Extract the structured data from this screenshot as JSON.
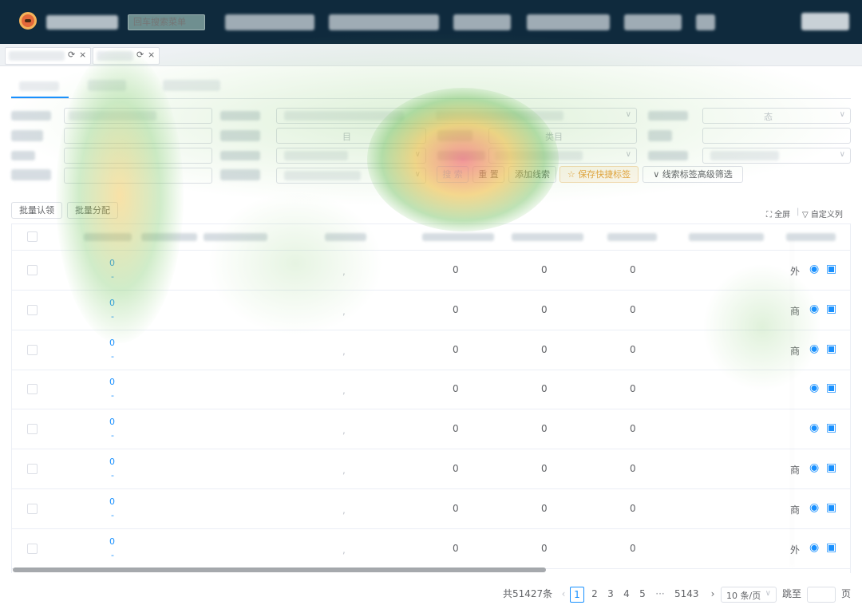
{
  "topbar": {
    "search_placeholder": "回车搜索菜单"
  },
  "tabs": [
    {
      "label": "",
      "close": "×"
    },
    {
      "label": "",
      "close": "×"
    }
  ],
  "filters": {
    "fields": [
      {
        "text": ""
      },
      {
        "text": "",
        "caret": "∨"
      },
      {
        "text": "态",
        "caret": "∨"
      },
      {
        "text": ""
      },
      {
        "text": "目"
      },
      {
        "text": "类目"
      },
      {
        "text": ""
      },
      {
        "text": "",
        "caret": "∨"
      },
      {
        "text": "",
        "caret": "∨"
      },
      {
        "text": "",
        "caret": "∨"
      },
      {
        "text": ""
      },
      {
        "text": "",
        "caret": "∨"
      }
    ],
    "search_label": "搜 索",
    "reset_label": "重 置",
    "add_clue_label": "添加线索",
    "save_quick_tag_label": "保存快捷标签",
    "advanced_filter_label": "线索标签高级筛选"
  },
  "toolbar": {
    "batch_claim_label": "批量认领",
    "batch_assign_label": "批量分配",
    "fullscreen_label": "全屏",
    "custom_columns_label": "自定义列"
  },
  "table": {
    "rows": [
      {
        "id": "0",
        "sub": "-",
        "dot": ",",
        "c1": "0",
        "c2": "0",
        "c3": "0",
        "tag": "外"
      },
      {
        "id": "0",
        "sub": "-",
        "dot": ",",
        "c1": "0",
        "c2": "0",
        "c3": "0",
        "tag": "商"
      },
      {
        "id": "0",
        "sub": "-",
        "dot": ",",
        "c1": "0",
        "c2": "0",
        "c3": "0",
        "tag": "商"
      },
      {
        "id": "0",
        "sub": "-",
        "dot": ",",
        "c1": "0",
        "c2": "0",
        "c3": "0",
        "tag": ""
      },
      {
        "id": "0",
        "sub": "-",
        "dot": ",",
        "c1": "0",
        "c2": "0",
        "c3": "0",
        "tag": ""
      },
      {
        "id": "0",
        "sub": "-",
        "dot": ",",
        "c1": "0",
        "c2": "0",
        "c3": "0",
        "tag": "商"
      },
      {
        "id": "0",
        "sub": "-",
        "dot": ",",
        "c1": "0",
        "c2": "0",
        "c3": "0",
        "tag": "商"
      },
      {
        "id": "0",
        "sub": "-",
        "dot": ",",
        "c1": "0",
        "c2": "0",
        "c3": "0",
        "tag": "外"
      }
    ]
  },
  "pagination": {
    "total": "共51427条",
    "pages": [
      "1",
      "2",
      "3",
      "4",
      "5"
    ],
    "ellipsis": "···",
    "last_page": "5143",
    "page_size": "10 条/页",
    "jump_label": "跳至",
    "page_suffix": "页"
  },
  "colors": {
    "accent": "#1890ff",
    "topbar": "#0f2a3d",
    "warning": "#e6a23c"
  }
}
